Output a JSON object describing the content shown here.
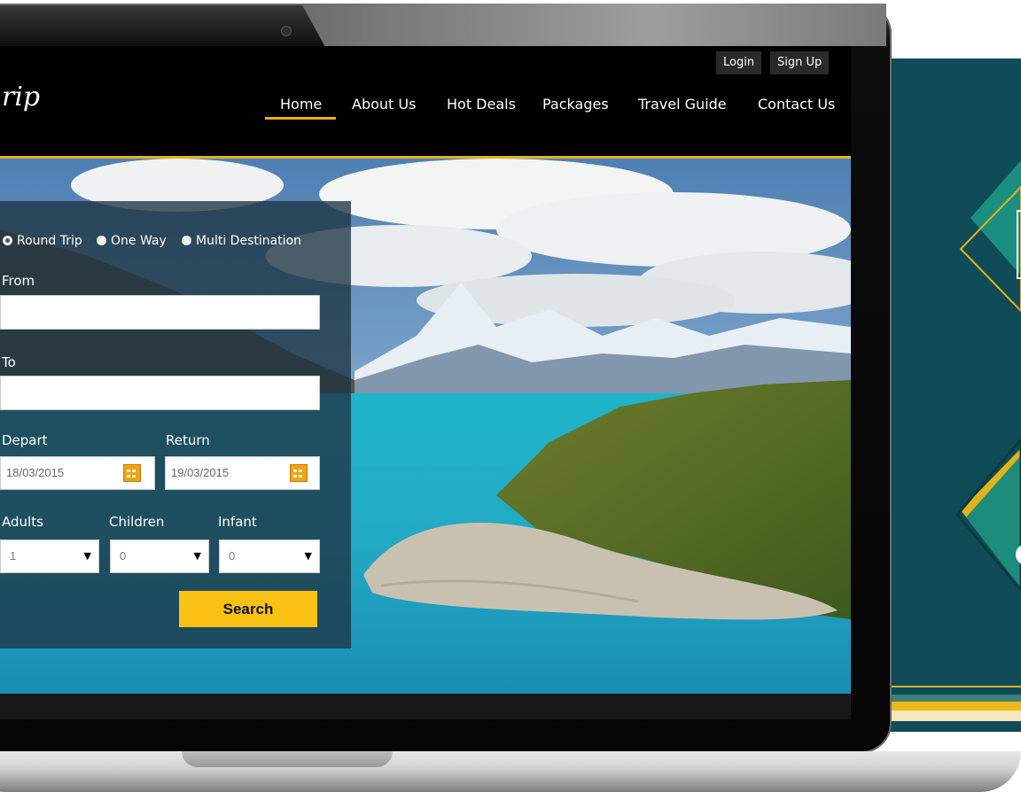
{
  "site": {
    "logo_text": "rip",
    "top_links": {
      "login": "Login",
      "signup": "Sign Up"
    },
    "nav": [
      "Home",
      "About Us",
      "Hot Deals",
      "Packages",
      "Travel Guide",
      "Contact Us"
    ],
    "active_nav": "Home"
  },
  "search": {
    "trip_types": [
      "Round Trip",
      "One Way",
      "Multi Destination"
    ],
    "selected_trip_type": "Round Trip",
    "from_label": "From",
    "from_value": "",
    "to_label": "To",
    "to_value": "",
    "depart_label": "Depart",
    "depart_value": "18/03/2015",
    "return_label": "Return",
    "return_value": "19/03/2015",
    "adults_label": "Adults",
    "adults_value": "1",
    "children_label": "Children",
    "children_value": "0",
    "infant_label": "Infant",
    "infant_value": "0",
    "search_label": "Search"
  },
  "colors": {
    "accent": "#e3b21a",
    "button": "#f8c113",
    "header_bg": "#000000",
    "panel_bg": "#1e3442",
    "side_panel": "#0f4c57",
    "side_teal": "#1e8c7a"
  }
}
